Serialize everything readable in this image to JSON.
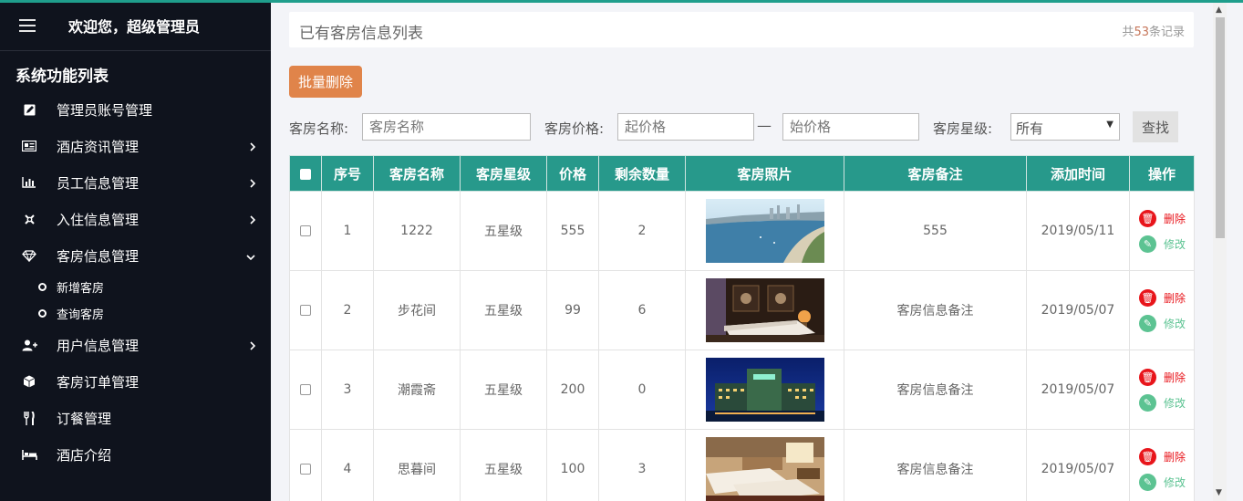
{
  "header": {
    "welcome": "欢迎您，超级管理员"
  },
  "sidebar": {
    "title": "系统功能列表",
    "items": [
      {
        "label": "管理员账号管理",
        "icon": "edit-icon"
      },
      {
        "label": "酒店资讯管理",
        "icon": "newspaper-icon"
      },
      {
        "label": "员工信息管理",
        "icon": "bar-chart-icon"
      },
      {
        "label": "入住信息管理",
        "icon": "link-icon"
      },
      {
        "label": "客房信息管理",
        "icon": "diamond-icon"
      },
      {
        "label": "用户信息管理",
        "icon": "user-add-icon"
      },
      {
        "label": "客房订单管理",
        "icon": "cube-icon"
      },
      {
        "label": "订餐管理",
        "icon": "cutlery-icon"
      },
      {
        "label": "酒店介绍",
        "icon": "bed-icon"
      }
    ],
    "sub_items": [
      "新增客房",
      "查询客房"
    ]
  },
  "panel": {
    "title": "已有客房信息列表",
    "count_prefix": "共",
    "count": "53",
    "count_suffix": "条记录"
  },
  "toolbar": {
    "batch_delete": "批量删除"
  },
  "filter": {
    "name_label": "客房名称:",
    "name_placeholder": "客房名称",
    "price_label": "客房价格:",
    "price_from_placeholder": "起价格",
    "dash": "—",
    "price_to_placeholder": "始价格",
    "star_label": "客房星级:",
    "star_value": "所有",
    "search_label": "查找"
  },
  "table": {
    "columns": [
      "序号",
      "客房名称",
      "客房星级",
      "价格",
      "剩余数量",
      "客房照片",
      "客房备注",
      "添加时间",
      "操作"
    ],
    "rows": [
      {
        "no": "1",
        "name": "1222",
        "star": "五星级",
        "price": "555",
        "remain": "2",
        "photo": "coastal-bay-photo",
        "note": "555",
        "date": "2019/05/11"
      },
      {
        "no": "2",
        "name": "步花间",
        "star": "五星级",
        "price": "99",
        "remain": "6",
        "photo": "hotel-room-photo",
        "note": "客房信息备注",
        "date": "2019/05/07"
      },
      {
        "no": "3",
        "name": "潮霞斋",
        "star": "五星级",
        "price": "200",
        "remain": "0",
        "photo": "hotel-night-exterior-photo",
        "note": "客房信息备注",
        "date": "2019/05/07"
      },
      {
        "no": "4",
        "name": "思暮间",
        "star": "五星级",
        "price": "100",
        "remain": "3",
        "photo": "twin-bedroom-photo",
        "note": "客房信息备注",
        "date": "2019/05/07"
      }
    ],
    "actions": {
      "delete": "删除",
      "edit": "修改"
    }
  },
  "colors": {
    "accent": "#27998b",
    "sidebar_bg": "#0f131d",
    "batch_btn": "#e0844a",
    "delete": "#e8151b",
    "edit": "#5cc392"
  }
}
